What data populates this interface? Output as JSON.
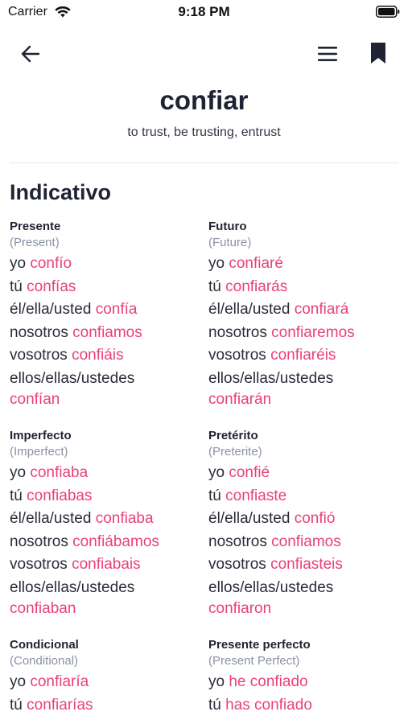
{
  "status": {
    "carrier": "Carrier",
    "time": "9:18 PM"
  },
  "verb": {
    "title": "confiar",
    "translation": "to trust, be trusting, entrust"
  },
  "mood": "Indicativo",
  "colors": {
    "accent": "#e8417a",
    "text": "#1f2333",
    "muted": "#8a91a8"
  },
  "icons": {
    "back": "arrow-left-icon",
    "menu": "hamburger-menu-icon",
    "bookmark": "bookmark-icon"
  },
  "tenses": [
    {
      "name": "Presente",
      "en": "(Present)",
      "rows": [
        {
          "p": "yo",
          "f": "confío"
        },
        {
          "p": "tú",
          "f": "confías"
        },
        {
          "p": "él/ella/usted",
          "f": "confía"
        },
        {
          "p": "nosotros",
          "f": "confiamos"
        },
        {
          "p": "vosotros",
          "f": "confiáis"
        },
        {
          "p": "ellos/ellas/ustedes",
          "f": "confían"
        }
      ]
    },
    {
      "name": "Futuro",
      "en": "(Future)",
      "rows": [
        {
          "p": "yo",
          "f": "confiaré"
        },
        {
          "p": "tú",
          "f": "confiarás"
        },
        {
          "p": "él/ella/usted",
          "f": "confiará"
        },
        {
          "p": "nosotros",
          "f": "confiaremos"
        },
        {
          "p": "vosotros",
          "f": "confiaréis"
        },
        {
          "p": "ellos/ellas/ustedes",
          "f": "confiarán"
        }
      ]
    },
    {
      "name": "Imperfecto",
      "en": "(Imperfect)",
      "rows": [
        {
          "p": "yo",
          "f": "confiaba"
        },
        {
          "p": "tú",
          "f": "confiabas"
        },
        {
          "p": "él/ella/usted",
          "f": "confiaba"
        },
        {
          "p": "nosotros",
          "f": "confiábamos"
        },
        {
          "p": "vosotros",
          "f": "confiabais"
        },
        {
          "p": "ellos/ellas/ustedes",
          "f": "confiaban"
        }
      ]
    },
    {
      "name": "Pretérito",
      "en": "(Preterite)",
      "rows": [
        {
          "p": "yo",
          "f": "confié"
        },
        {
          "p": "tú",
          "f": "confiaste"
        },
        {
          "p": "él/ella/usted",
          "f": "confió"
        },
        {
          "p": "nosotros",
          "f": "confiamos"
        },
        {
          "p": "vosotros",
          "f": "confiasteis"
        },
        {
          "p": "ellos/ellas/ustedes",
          "f": "confiaron"
        }
      ]
    },
    {
      "name": "Condicional",
      "en": "(Conditional)",
      "rows": [
        {
          "p": "yo",
          "f": "confiaría"
        },
        {
          "p": "tú",
          "f": "confiarías"
        }
      ]
    },
    {
      "name": "Presente perfecto",
      "en": "(Present Perfect)",
      "rows": [
        {
          "p": "yo",
          "f": "he confiado"
        },
        {
          "p": "tú",
          "f": "has confiado"
        }
      ]
    }
  ]
}
